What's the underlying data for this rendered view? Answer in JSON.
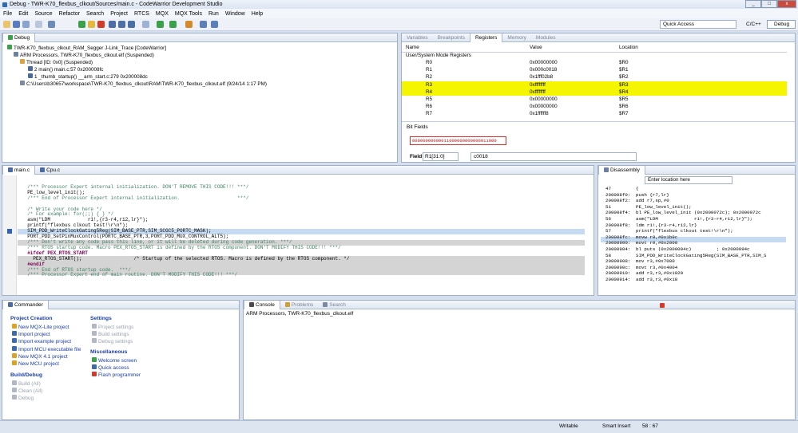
{
  "titlebar": {
    "title": "Debug - TWR-K70_flexbus_clkout/Sources/main.c - CodeWarrior Development Studio"
  },
  "menu": [
    "File",
    "Edit",
    "Source",
    "Refactor",
    "Search",
    "Project",
    "RTCS",
    "MQX",
    "MQX Tools",
    "Run",
    "Window",
    "Help"
  ],
  "toolbar": {
    "quick_access": "Quick Access",
    "persp_cc": "C/C++",
    "persp_debug": "Debug"
  },
  "debug": {
    "tab": "Debug",
    "tree": [
      "TWR-K70_flexbus_clkout_RAM_Segger J-Link_Trace [CodeWarrior]",
      "ARM Processors, TWR-K70_flexbus_clkout.elf (Suspended)",
      "Thread [ID: 0x0] (Suspended)",
      "2 main() main.c:57 0x200008fc",
      "1 _thumb_startup() __arm_start.c:279 0x200008dc",
      "C:\\Users\\b30657\\workspace\\TWR-K70_flexbus_clkout\\RAM\\TWR-K70_flexbus_clkout.elf (9/24/14 1:17 PM)"
    ]
  },
  "regs": {
    "tabs": [
      "Variables",
      "Breakpoints",
      "Registers",
      "Memory",
      "Modules"
    ],
    "cols": [
      "Name",
      "Value",
      "Location"
    ],
    "group": "User/System Mode Registers",
    "rows": [
      [
        "R0",
        "0x00000000",
        "$R0"
      ],
      [
        "R1",
        "0x000c0018",
        "$R1"
      ],
      [
        "R2",
        "0x1fff02b8",
        "$R2"
      ],
      [
        "R3",
        "0xffffffff",
        "$R3"
      ],
      [
        "R4",
        "0xffffffff",
        "$R4"
      ],
      [
        "R5",
        "0x00000000",
        "$R5"
      ],
      [
        "R6",
        "0x00000000",
        "$R6"
      ],
      [
        "R7",
        "0x1ffffff8",
        "$R7"
      ]
    ],
    "bitfields": "Bit Fields",
    "bits": "00000000000011000000000000011000",
    "field_label": "Field",
    "field_sel": "R1[31:0]",
    "field_val": "c0018"
  },
  "editor": {
    "tabs": [
      "main.c",
      "Cpu.c"
    ],
    "lines": [
      "  /*** Processor Expert internal initialization. DON'T REMOVE THIS CODE!!! ***/",
      "  PE_low_level_init();",
      "  /*** End of Processor Expert internal initialization.                    ***/",
      "",
      "  /* Write your code here */",
      "  /* For example: for(;;) { } */",
      "  asm(\"LDM             r1!,{r3-r4,r12,lr}\");",
      "  printf(\"flexbus clkout test!\\r\\n\");",
      "  SIM_PDD_WriteClockGating5Reg(SIM_BASE_PTR,SIM_SCGC5_PORTC_MASK);",
      "  PORT_PDD_SetPinMuxControl(PORTC_BASE_PTR,3,PORT_PDD_MUX_CONTROL_ALT5);",
      "  /*** Don't write any code pass this line, or it will be deleted during code generation. ***/",
      "  /*** RTOS startup code. Macro PEX_RTOS_START is defined by the RTOS component. DON'T MODIFY THIS CODE!!! ***/",
      "  #ifdef PEX_RTOS_START",
      "    PEX_RTOS_START();                  /* Startup of the selected RTOS. Macro is defined by the RTOS component. */",
      "  #endif",
      "  /*** End of RTOS startup code.  ***/",
      "  /*** Processor Expert end of main routine. DON'T MODIFY THIS CODE!!! ***/"
    ]
  },
  "disasm": {
    "tab": "Disassembly",
    "location": "Enter location here",
    "lines": [
      [
        "47",
        "{"
      ],
      [
        "200008f0:",
        "push {r7,lr}"
      ],
      [
        "200008f2:",
        "add r7,sp,#0"
      ],
      [
        "51",
        "PE_low_level_init();"
      ],
      [
        "200008f4:",
        "bl PE_low_level_init (0x2000072c); 0x2000072c"
      ],
      [
        "56",
        "asm(\"LDM             r1!,{r3-r4,r12,lr}\");"
      ],
      [
        "200008f8:",
        "ldm r1!,{r3-r4,r12,lr}"
      ],
      [
        "57",
        "printf(\"flexbus clkout test!\\r\\n\");"
      ],
      [
        "200008fc:",
        "movw r0,#0x1b9c"
      ],
      [
        "20000900:",
        "movt r0,#0x2000"
      ],
      [
        "20000904:",
        "bl puts (0x2000094c)         ; 0x2000094c"
      ],
      [
        "58",
        "SIM_PDD_WriteClockGating5Reg(SIM_BASE_PTR,SIM_S"
      ],
      [
        "20000908:",
        "mov r3,#0x7000"
      ],
      [
        "2000090c:",
        "movt r3,#0x4004"
      ],
      [
        "20000910:",
        "add r3,r3,#0x1020"
      ],
      [
        "20000914:",
        "add r3,r3,#0x18"
      ]
    ]
  },
  "commander": {
    "tab": "Commander",
    "pc_title": "Project Creation",
    "pc": [
      "New MQX-Lite project",
      "Import project",
      "Import example project",
      "Import MCU executable file",
      "New MQX 4.1 project",
      "New MCU project"
    ],
    "bd_title": "Build/Debug",
    "bd": [
      "Build (All)",
      "Clean (All)",
      "Debug"
    ],
    "set_title": "Settings",
    "set": [
      "Project settings",
      "Build settings",
      "Debug settings"
    ],
    "misc_title": "Miscellaneous",
    "misc": [
      "Welcome screen",
      "Quick access",
      "Flash programmer"
    ]
  },
  "console": {
    "tabs": [
      "Console",
      "Problems",
      "Search"
    ],
    "text": "ARM Processors, TWR-K70_flexbus_clkout.elf"
  },
  "status": {
    "writable": "Writable",
    "insert": "Smart Insert",
    "pos": "58 : 67"
  }
}
